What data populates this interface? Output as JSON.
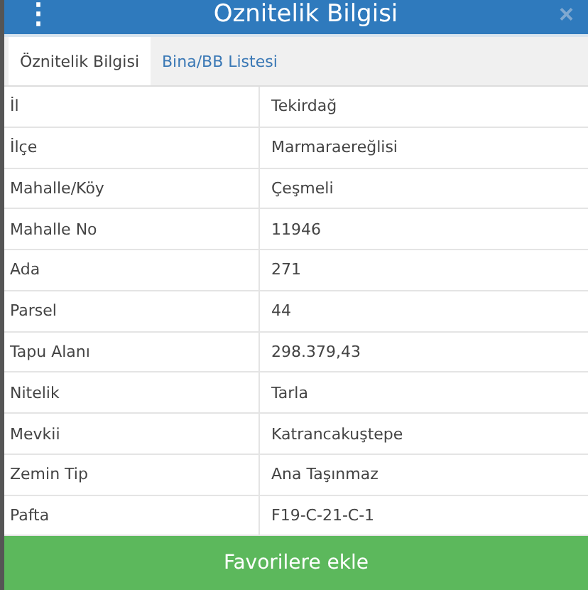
{
  "header": {
    "menu_icon": "⋮",
    "title": "Oznitelik Bilgisi",
    "close_icon": "×"
  },
  "tabs": [
    {
      "label": "Öznitelik Bilgisi",
      "selected": true
    },
    {
      "label": "Bina/BB Listesi",
      "selected": false
    }
  ],
  "attributes": [
    {
      "name": "İl",
      "value": "Tekirdağ"
    },
    {
      "name": "İlçe",
      "value": "Marmaraereğlisi"
    },
    {
      "name": "Mahalle/Köy",
      "value": "Çeşmeli"
    },
    {
      "name": "Mahalle No",
      "value": "11946"
    },
    {
      "name": "Ada",
      "value": "271"
    },
    {
      "name": "Parsel",
      "value": "44"
    },
    {
      "name": "Tapu Alanı",
      "value": "298.379,43"
    },
    {
      "name": "Nitelik",
      "value": "Tarla"
    },
    {
      "name": "Mevkii",
      "value": "Katrancakuştepe"
    },
    {
      "name": "Zemin Tip",
      "value": "Ana Taşınmaz"
    },
    {
      "name": "Pafta",
      "value": "F19-C-21-C-1"
    }
  ],
  "button": {
    "label": "Favorilere ekle"
  }
}
